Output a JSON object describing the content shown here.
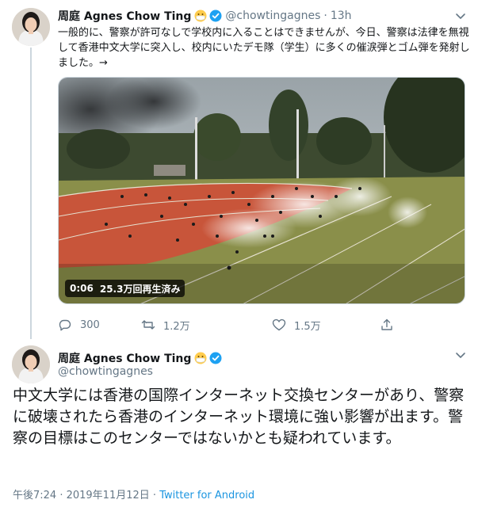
{
  "colors": {
    "accent": "#1da1f2",
    "secondary_text": "#657786",
    "link": "#1b95e0",
    "border": "#ccd6dd"
  },
  "tweet1": {
    "author": {
      "display_name": "周庭 Agnes Chow Ting",
      "handle": "@chowtingagnes",
      "verified": true,
      "emoji": "face-with-medical-mask"
    },
    "time": "13h",
    "text": "一般的に、警察が許可なしで学校内に入ることはできませんが、今日、警察は法律を無視して香港中文大学に突入し、校内にいたデモ隊（学生）に多くの催涙弾とゴム弾を発射しました。→",
    "media": {
      "type": "video",
      "duration": "0:06",
      "views": "25.3万回再生済み"
    },
    "actions": {
      "replies": "300",
      "retweets": "1.2万",
      "likes": "1.5万"
    },
    "icons": [
      "reply-icon",
      "retweet-icon",
      "like-icon",
      "share-icon",
      "chevron-down-icon"
    ]
  },
  "tweet2": {
    "author": {
      "display_name": "周庭 Agnes Chow Ting",
      "handle": "@chowtingagnes",
      "verified": true,
      "emoji": "face-with-medical-mask"
    },
    "text": "中文大学には香港の国際インターネット交換センターがあり、警察に破壊されたら香港のインターネット環境に強い影響が出ます。警察の目標はこのセンターではないかとも疑われています。",
    "timestamp": "午後7:24 · 2019年11月12日",
    "separator": "·",
    "client": "Twitter for Android"
  }
}
